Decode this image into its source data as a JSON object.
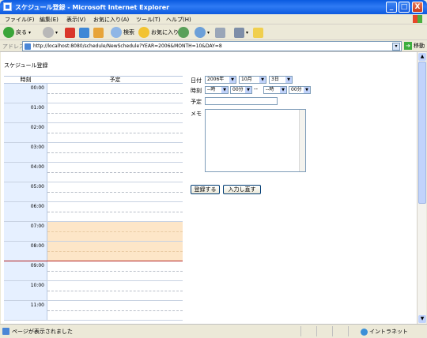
{
  "window": {
    "title": "スケジュール登録 - Microsoft Internet Explorer",
    "controls": [
      "_",
      "□",
      "X"
    ]
  },
  "menu": [
    "ファイル(F)",
    "編集(E)",
    "表示(V)",
    "お気に入り(A)",
    "ツール(T)",
    "ヘルプ(H)"
  ],
  "toolbar": {
    "back": "戻る",
    "search": "検索",
    "favorites": "お気に入り"
  },
  "address": {
    "label": "アドレス(D)",
    "url": "http://localhost:8080/schedule/NewSchedule?YEAR=2006&MONTH=10&DAY=8",
    "go": "移動"
  },
  "page": {
    "title": "スケジュール登録",
    "table_headers": {
      "time": "時刻",
      "plan": "予定"
    },
    "hours": [
      "00:00",
      "01:00",
      "02:00",
      "03:00",
      "04:00",
      "05:00",
      "06:00",
      "07:00",
      "08:00",
      "09:00",
      "10:00",
      "11:00"
    ],
    "booked_rows": [
      "07:00",
      "08:00"
    ]
  },
  "form": {
    "date_label": "日付",
    "year": "2006年",
    "month": "10月",
    "day": "3日",
    "time_label": "時刻",
    "start_hour": "--時",
    "start_min": "00分",
    "dash": "--",
    "end_hour": "--時",
    "end_min": "00分",
    "plan_label": "予定",
    "memo_label": "メモ",
    "submit": "登録する",
    "reset": "入力し直す"
  },
  "status": {
    "text": "ページが表示されました",
    "zone": "イントラネット"
  }
}
